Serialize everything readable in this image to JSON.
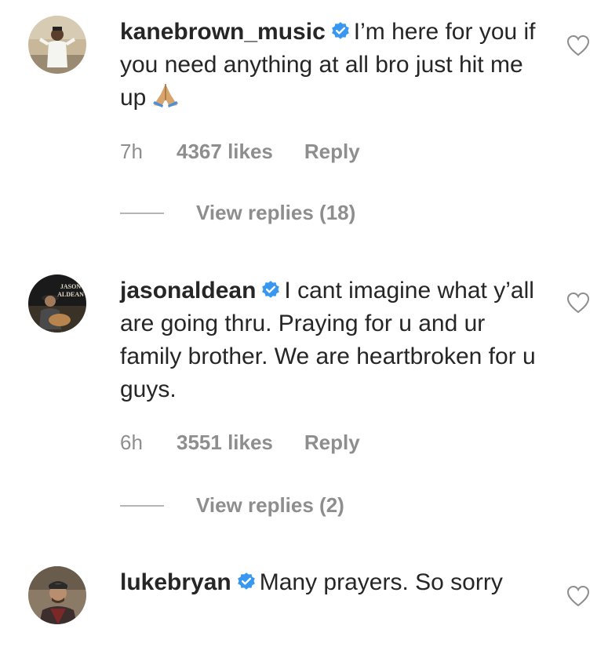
{
  "comments": [
    {
      "username": "kanebrown_music",
      "text": "I’m here for you if you need anything at all bro just hit me up",
      "emoji": "folded-hands-emoji",
      "time": "7h",
      "likes": "4367 likes",
      "reply": "Reply",
      "view_replies": "View replies (18)"
    },
    {
      "username": "jasonaldean",
      "text": "I cant imagine what y’all are going thru. Praying for u and ur family brother. We are heartbroken for u guys.",
      "time": "6h",
      "likes": "3551 likes",
      "reply": "Reply",
      "view_replies": "View replies (2)",
      "avatar_text": "JASON ALDEAN"
    },
    {
      "username": "lukebryan",
      "text": "Many prayers. So sorry"
    }
  ],
  "colors": {
    "text": "#262626",
    "meta": "#8e8e8e",
    "verified": "#3897f0"
  },
  "icons": {
    "verified": "verified-badge-icon",
    "like": "heart-outline-icon"
  }
}
